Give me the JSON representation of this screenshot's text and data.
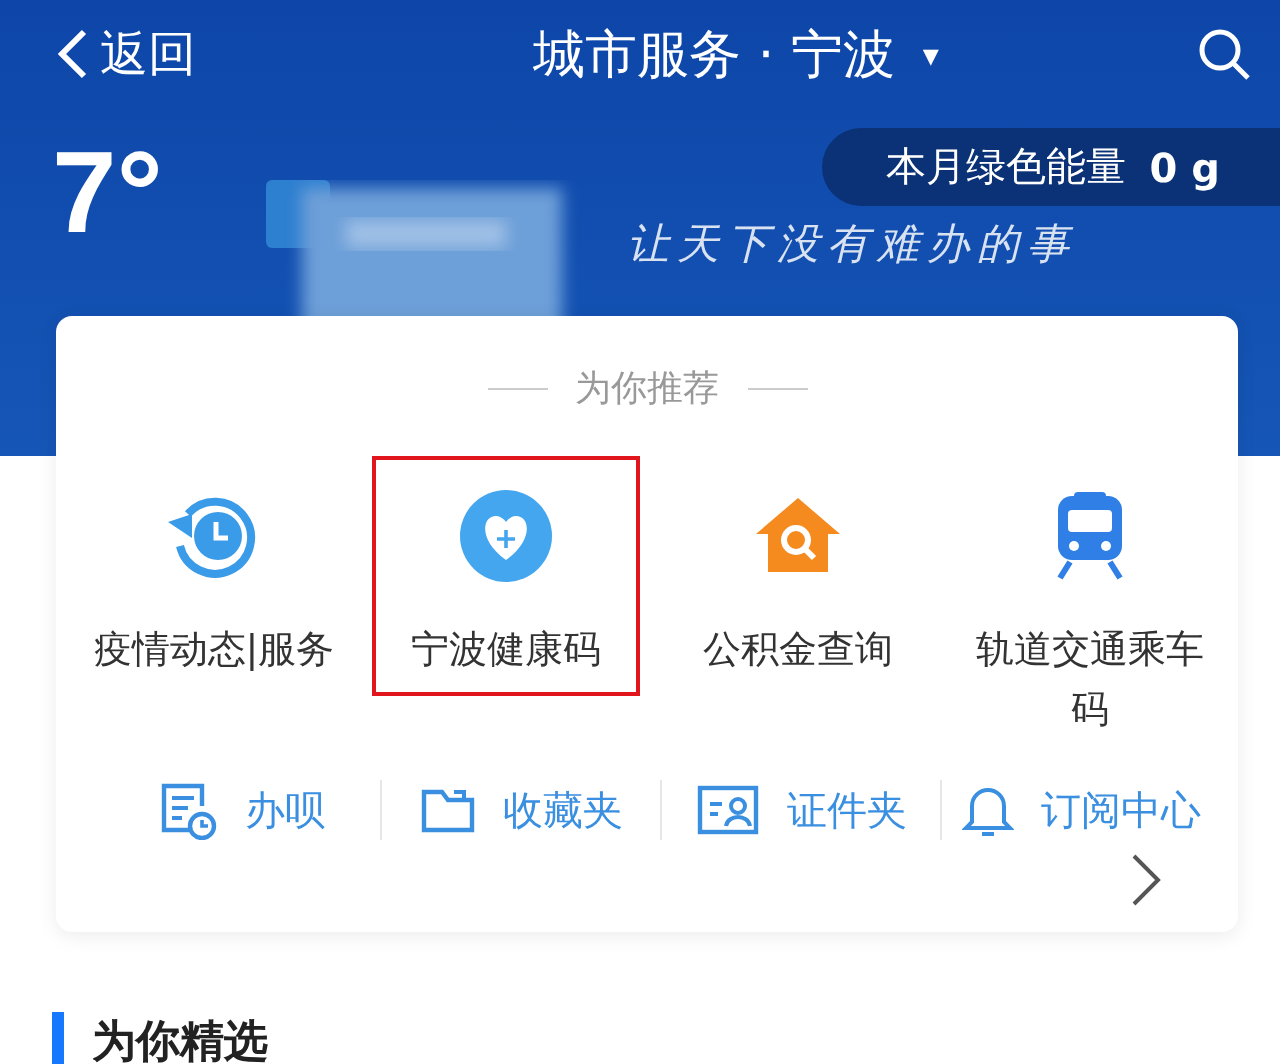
{
  "top_bar": {
    "back_label": "返回",
    "title": "城市服务 · 宁波",
    "caret": "▾"
  },
  "banner": {
    "temperature": "7°",
    "slogan": "让天下没有难办的事",
    "green_energy": "本月绿色能量",
    "green_value": "0 g"
  },
  "recommend": {
    "title": "为你推荐",
    "items": [
      {
        "kind": "clock",
        "label": "疫情动态|服务",
        "highlighted": false
      },
      {
        "kind": "heart",
        "label": "宁波健康码",
        "highlighted": true
      },
      {
        "kind": "house",
        "label": "公积金查询",
        "highlighted": false
      },
      {
        "kind": "train",
        "label": "轨道交通乘车码",
        "highlighted": false
      }
    ],
    "shortcuts": [
      {
        "kind": "doc",
        "label": "办呗"
      },
      {
        "kind": "folder",
        "label": "收藏夹"
      },
      {
        "kind": "card",
        "label": "证件夹"
      },
      {
        "kind": "bell",
        "label": "订阅中心"
      }
    ]
  },
  "section": {
    "title": "为你精选"
  }
}
